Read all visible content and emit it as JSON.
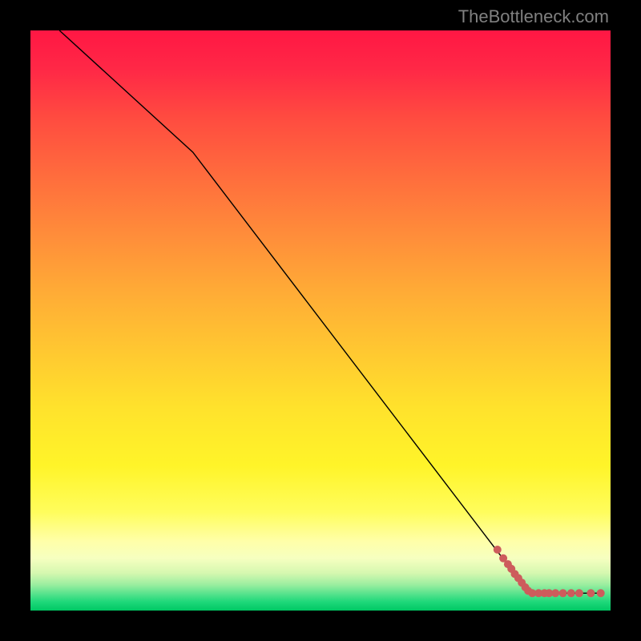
{
  "watermark": "TheBottleneck.com",
  "chart_data": {
    "type": "line",
    "title": "",
    "xlabel": "",
    "ylabel": "",
    "xlim": [
      0,
      100
    ],
    "ylim": [
      0,
      100
    ],
    "grid": false,
    "line": {
      "points": [
        {
          "x": 5,
          "y": 100
        },
        {
          "x": 28,
          "y": 79
        },
        {
          "x": 86,
          "y": 3
        },
        {
          "x": 98,
          "y": 3
        }
      ],
      "color": "#000000",
      "width": 1.4
    },
    "scatter": {
      "points": [
        {
          "x": 80.5,
          "y": 10.5
        },
        {
          "x": 81.5,
          "y": 9.0
        },
        {
          "x": 82.3,
          "y": 8.0
        },
        {
          "x": 82.9,
          "y": 7.2
        },
        {
          "x": 83.5,
          "y": 6.3
        },
        {
          "x": 84.1,
          "y": 5.6
        },
        {
          "x": 84.7,
          "y": 4.8
        },
        {
          "x": 85.3,
          "y": 4.0
        },
        {
          "x": 85.8,
          "y": 3.4
        },
        {
          "x": 86.5,
          "y": 3.0
        },
        {
          "x": 87.6,
          "y": 3.0
        },
        {
          "x": 88.6,
          "y": 3.0
        },
        {
          "x": 89.4,
          "y": 3.0
        },
        {
          "x": 90.5,
          "y": 3.0
        },
        {
          "x": 91.8,
          "y": 3.0
        },
        {
          "x": 93.2,
          "y": 3.0
        },
        {
          "x": 94.6,
          "y": 3.0
        },
        {
          "x": 96.6,
          "y": 3.0
        },
        {
          "x": 98.3,
          "y": 3.0
        }
      ],
      "color": "#cd5c5c",
      "radius": 5
    },
    "background_gradient": {
      "stops": [
        {
          "offset": 0.0,
          "color": "#ff1744"
        },
        {
          "offset": 0.07,
          "color": "#ff2946"
        },
        {
          "offset": 0.15,
          "color": "#ff4b40"
        },
        {
          "offset": 0.25,
          "color": "#ff6c3d"
        },
        {
          "offset": 0.35,
          "color": "#ff8c3a"
        },
        {
          "offset": 0.45,
          "color": "#ffab36"
        },
        {
          "offset": 0.55,
          "color": "#ffc731"
        },
        {
          "offset": 0.65,
          "color": "#ffe22c"
        },
        {
          "offset": 0.75,
          "color": "#fff429"
        },
        {
          "offset": 0.83,
          "color": "#fffd5c"
        },
        {
          "offset": 0.88,
          "color": "#ffffa8"
        },
        {
          "offset": 0.91,
          "color": "#f6ffc0"
        },
        {
          "offset": 0.935,
          "color": "#d6f8b0"
        },
        {
          "offset": 0.955,
          "color": "#9ceea0"
        },
        {
          "offset": 0.97,
          "color": "#5ce38e"
        },
        {
          "offset": 0.985,
          "color": "#1ed87a"
        },
        {
          "offset": 1.0,
          "color": "#00c864"
        }
      ]
    }
  }
}
